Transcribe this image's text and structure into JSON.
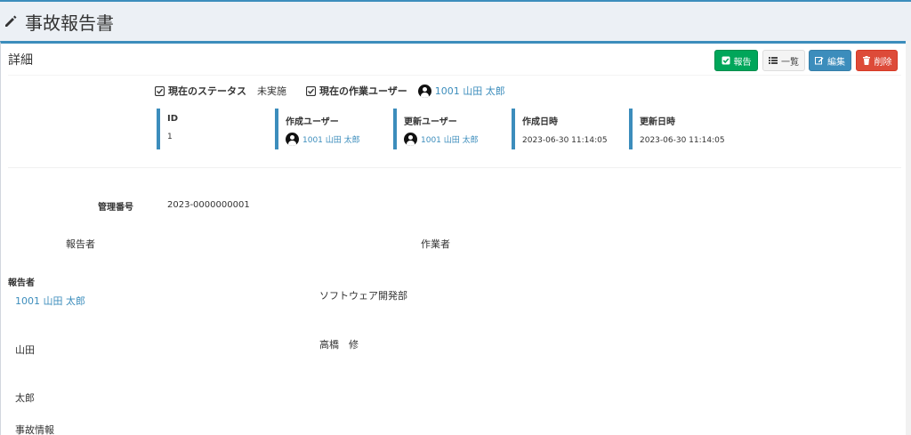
{
  "page": {
    "title": "事故報告書"
  },
  "box": {
    "title": "詳細"
  },
  "toolbar": {
    "report_label": "報告",
    "list_label": "一覧",
    "edit_label": "編集",
    "delete_label": "削除"
  },
  "status": {
    "current_status_label": "現在のステータス",
    "current_status_value": "未実施",
    "current_user_label": "現在の作業ユーザー",
    "current_user_value": "1001 山田 太郎"
  },
  "meta": {
    "id_label": "ID",
    "id_value": "1",
    "creator_label": "作成ユーザー",
    "creator_value": "1001 山田 太郎",
    "updater_label": "更新ユーザー",
    "updater_value": "1001 山田 太郎",
    "created_label": "作成日時",
    "created_value": "2023-06-30 11:14:05",
    "updated_label": "更新日時",
    "updated_value": "2023-06-30 11:14:05"
  },
  "form": {
    "management_no_label": "管理番号",
    "management_no_value": "2023-0000000001",
    "reporter_header": "報告者",
    "worker_header": "作業者",
    "reporter_label": "報告者",
    "reporter_value": "1001 山田 太郎",
    "department_value": "ソフトウェア開発部",
    "last_name_value": "山田",
    "worker_name_value": "高橋　修",
    "first_name_value": "太郎",
    "accident_info_label": "事故情報"
  },
  "colors": {
    "primary": "#3c8dbc",
    "success": "#00a65a",
    "danger": "#dd4b39",
    "default": "#f4f4f4"
  }
}
